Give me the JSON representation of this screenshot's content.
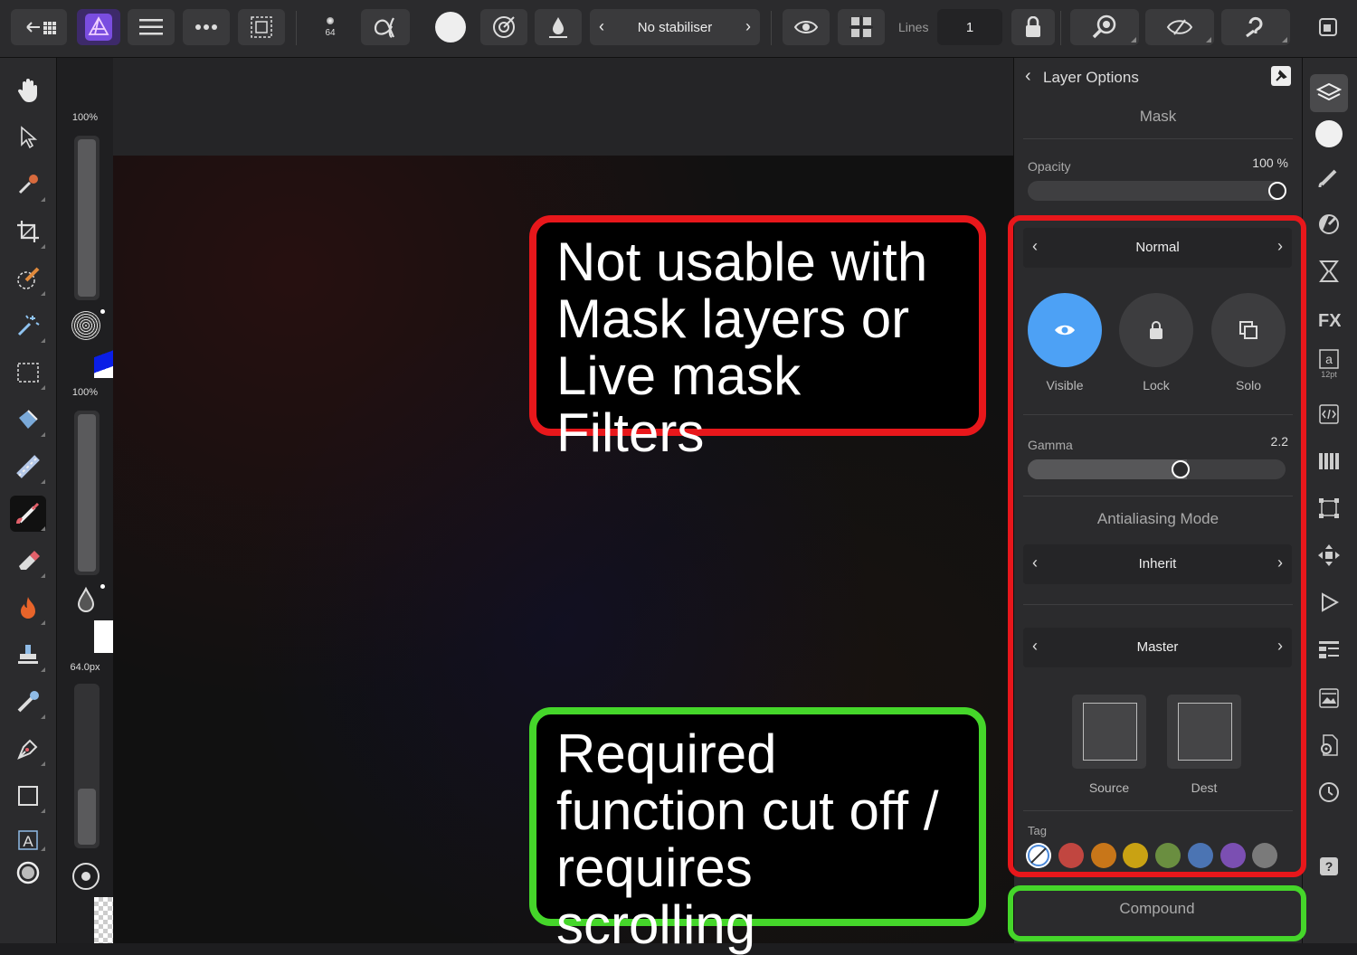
{
  "toolbar": {
    "brush_size_value": "64",
    "stabiliser_label": "No stabiliser",
    "lines_label": "Lines",
    "lines_value": "1"
  },
  "left_sliders": {
    "top_value": "100%",
    "middle_value": "100%",
    "bottom_value": "64.0px"
  },
  "panel": {
    "title": "Layer Options",
    "section": "Mask",
    "opacity_label": "Opacity",
    "opacity_value": "100 %",
    "opacity_level": 1.0,
    "blend_mode": "Normal",
    "visible_label": "Visible",
    "lock_label": "Lock",
    "solo_label": "Solo",
    "gamma_label": "Gamma",
    "gamma_value": "2.2",
    "antialiasing_title": "Antialiasing Mode",
    "antialiasing_value": "Inherit",
    "channel_value": "Master",
    "source_label": "Source",
    "dest_label": "Dest",
    "tag_label": "Tag",
    "tag_colors": [
      "#c14640",
      "#c87619",
      "#c9a213",
      "#6a8e40",
      "#4b74b3",
      "#7b4fb2",
      "#7a7a7a"
    ],
    "compound_label": "Compound"
  },
  "right_strip": {
    "text_icon_size": "12pt"
  },
  "annotations": {
    "red_line1": "Not usable with",
    "red_line2": "Mask layers or",
    "red_line3": "Live mask Filters",
    "green_line1": "Required",
    "green_line2": "function cut off /",
    "green_line3": "requires scrolling",
    "red_color": "#e8171b",
    "green_color": "#45d62a"
  }
}
